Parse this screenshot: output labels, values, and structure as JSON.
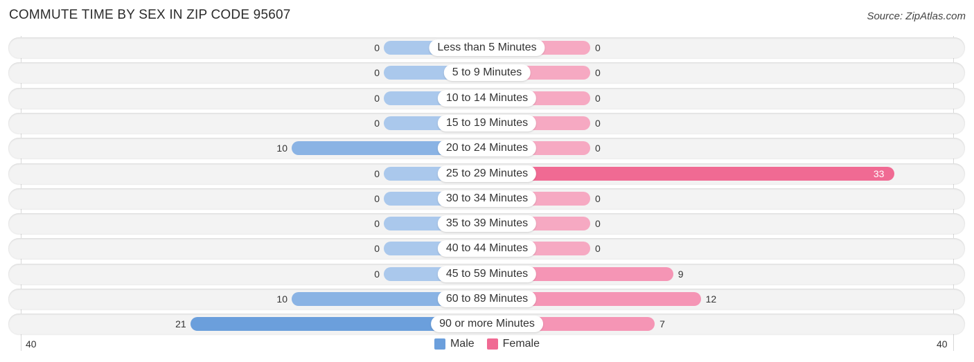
{
  "title": "COMMUTE TIME BY SEX IN ZIP CODE 95607",
  "source": "Source: ZipAtlas.com",
  "colors": {
    "male": "#6b9fdc",
    "male_light": "#aac8ec",
    "female": "#f06a93",
    "female_light": "#f6a9c2"
  },
  "chart_data": {
    "type": "bar",
    "orientation": "horizontal-diverging",
    "title": "COMMUTE TIME BY SEX IN ZIP CODE 95607",
    "categories": [
      "Less than 5 Minutes",
      "5 to 9 Minutes",
      "10 to 14 Minutes",
      "15 to 19 Minutes",
      "20 to 24 Minutes",
      "25 to 29 Minutes",
      "30 to 34 Minutes",
      "35 to 39 Minutes",
      "40 to 44 Minutes",
      "45 to 59 Minutes",
      "60 to 89 Minutes",
      "90 or more Minutes"
    ],
    "series": [
      {
        "name": "Male",
        "values": [
          0,
          0,
          0,
          0,
          10,
          0,
          0,
          0,
          0,
          0,
          10,
          21
        ]
      },
      {
        "name": "Female",
        "values": [
          0,
          0,
          0,
          0,
          0,
          33,
          0,
          0,
          0,
          9,
          12,
          7
        ]
      }
    ],
    "xlim": [
      40,
      40
    ],
    "axis_ticks": {
      "left": "40",
      "right": "40"
    },
    "legend": {
      "position": "bottom-center",
      "entries": [
        "Male",
        "Female"
      ]
    }
  }
}
